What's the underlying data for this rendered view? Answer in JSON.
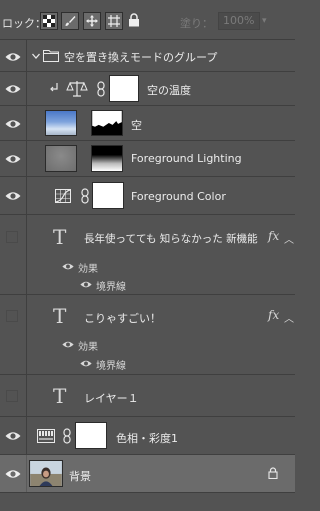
{
  "lockbar": {
    "lock_label": "ロック：",
    "fill_label": "塗り：",
    "fill_value": "100%"
  },
  "layers": {
    "group": {
      "name": "空を置き換えモードのグループ"
    },
    "sky_temp": {
      "name": "空の温度"
    },
    "sky": {
      "name": "空"
    },
    "fg_lighting": {
      "name": "Foreground Lighting"
    },
    "fg_color": {
      "name": "Foreground Color"
    },
    "text1": {
      "name": "長年使ってても 知らなかった 新機能",
      "effects_label": "効果",
      "effect_stroke": "境界線"
    },
    "text2": {
      "name": "こりゃすごい！",
      "effects_label": "効果",
      "effect_stroke": "境界線"
    },
    "text3": {
      "name": "レイヤー１"
    },
    "hue_sat": {
      "name": "色相・彩度1"
    },
    "background": {
      "name": "背景"
    }
  },
  "icons": {
    "fx_glyph": "fx",
    "text_glyph": "T"
  }
}
